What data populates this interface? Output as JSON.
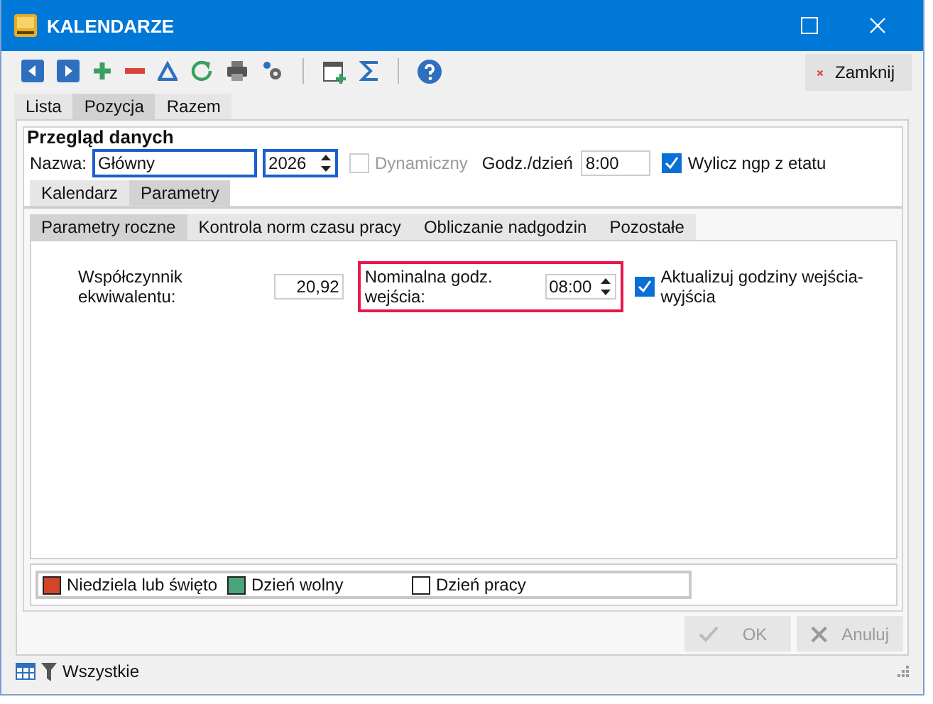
{
  "window": {
    "title": "KALENDARZE"
  },
  "close_button": {
    "label": "Zamknij"
  },
  "tabs": [
    {
      "label": "Lista",
      "selected": false
    },
    {
      "label": "Pozycja",
      "selected": true
    },
    {
      "label": "Razem",
      "selected": false
    }
  ],
  "overview": {
    "title": "Przegląd danych",
    "name_label": "Nazwa:",
    "name_value": "Główny",
    "year_value": "2026",
    "dynamic": {
      "label": "Dynamiczny",
      "checked": false,
      "disabled": true
    },
    "hours_label": "Godz./dzień",
    "hours_value": "8:00",
    "compute": {
      "label": "Wylicz ngp z etatu",
      "checked": true
    }
  },
  "subtabs": [
    {
      "label": "Kalendarz",
      "selected": false
    },
    {
      "label": "Parametry",
      "selected": true
    }
  ],
  "inner_tabs": [
    {
      "label": "Parametry roczne",
      "selected": true
    },
    {
      "label": "Kontrola norm czasu pracy",
      "selected": false
    },
    {
      "label": "Obliczanie nadgodzin",
      "selected": false
    },
    {
      "label": "Pozostałe",
      "selected": false
    }
  ],
  "params": {
    "factor_label": "Współczynnik ekwiwalentu:",
    "factor_value": "20,92",
    "nominal_label": "Nominalna godz. wejścia:",
    "nominal_value": "08:00",
    "nominal_highlighted": true,
    "update": {
      "label": "Aktualizuj godziny wejścia-wyjścia",
      "checked": true
    }
  },
  "legend": [
    {
      "label": "Niedziela lub święto",
      "color": "#d2452b"
    },
    {
      "label": "Dzień wolny",
      "color": "#4aa57a"
    },
    {
      "label": "Dzień pracy",
      "color": "#ffffff"
    }
  ],
  "buttons": [
    {
      "label": "OK",
      "disabled": true
    },
    {
      "label": "Anuluj",
      "disabled": true
    }
  ],
  "status_bar": {
    "filter": "Wszystkie"
  }
}
